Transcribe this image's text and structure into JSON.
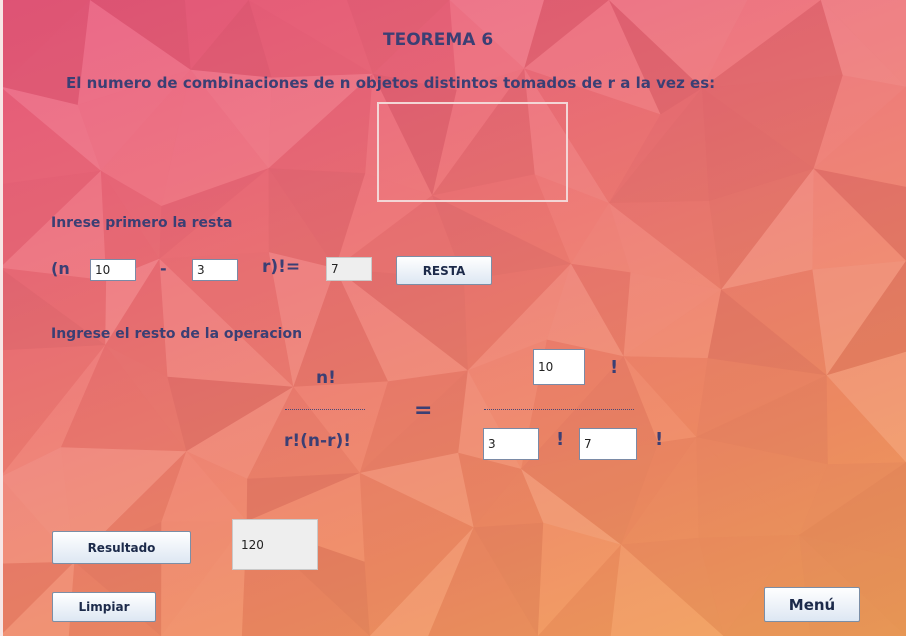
{
  "title": "TEOREMA 6",
  "subtitle": "El numero de combinaciones de n objetos distintos tomados de r a la vez es:",
  "resta": {
    "label": "Inrese primero la resta",
    "open_paren_n": "(n",
    "minus": "-",
    "close_r_fact_eq": "r)!=",
    "n_value": "10",
    "r_value": "3",
    "result_value": "7",
    "button_label": "RESTA"
  },
  "operacion": {
    "label": "Ingrese el resto de la operacion",
    "numerator": "n!",
    "denominator": "r!(n-r)!",
    "equals": "=",
    "n_value": "10",
    "r_value": "3",
    "nr_value": "7",
    "bang": "!"
  },
  "resultado": {
    "button_label": "Resultado",
    "value": "120"
  },
  "limpiar_label": "Limpiar",
  "menu_label": "Menú",
  "colors": {
    "text": "#3b3f74",
    "bg_top": "#e95a7e",
    "bg_bottom": "#f3a55a"
  }
}
